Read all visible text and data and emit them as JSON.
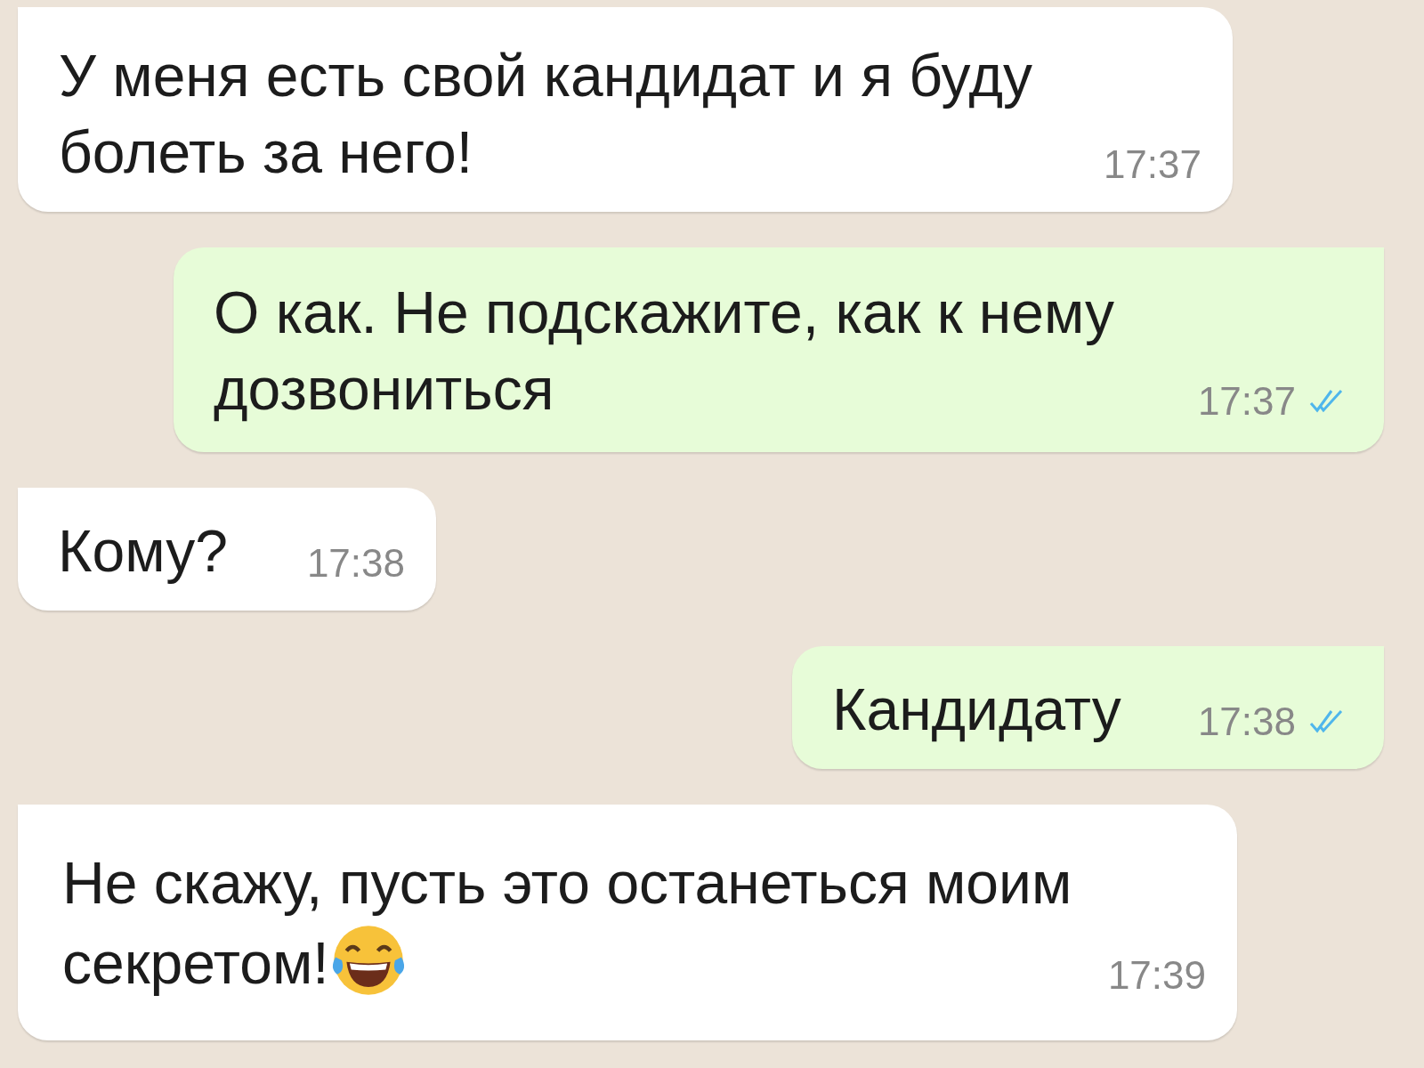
{
  "messages": [
    {
      "kind": "incoming",
      "text": "У меня есть свой кандидат и я буду\nболеть за него!",
      "time": "17:37"
    },
    {
      "kind": "outgoing",
      "text": "О как. Не подскажите, как к нему\nдозвониться",
      "time": "17:37",
      "read": true
    },
    {
      "kind": "incoming",
      "text": "Кому?",
      "time": "17:38"
    },
    {
      "kind": "outgoing",
      "text": "Кандидату",
      "time": "17:38",
      "read": true
    },
    {
      "kind": "incoming",
      "text": "Не скажу, пусть это останеться моим\nсекретом!",
      "has_emoji": true,
      "time": "17:39"
    }
  ]
}
